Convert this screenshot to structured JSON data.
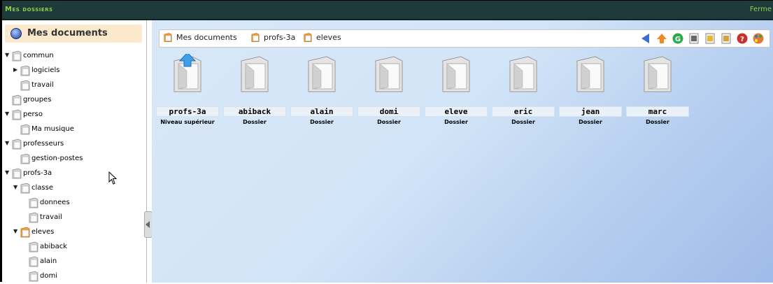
{
  "window": {
    "title": "Mes dossiers",
    "close_label": "Ferme"
  },
  "sidebar": {
    "header": "Mes documents",
    "items": [
      {
        "label": "commun",
        "arrow": "down"
      },
      {
        "label": "logiciels",
        "arrow": "right"
      },
      {
        "label": "travail",
        "arrow": ""
      },
      {
        "label": "groupes",
        "arrow": ""
      },
      {
        "label": "perso",
        "arrow": "down"
      },
      {
        "label": "Ma musique",
        "arrow": ""
      },
      {
        "label": "professeurs",
        "arrow": "down"
      },
      {
        "label": "gestion-postes",
        "arrow": ""
      },
      {
        "label": "profs-3a",
        "arrow": "down"
      },
      {
        "label": "classe",
        "arrow": "down"
      },
      {
        "label": "donnees",
        "arrow": ""
      },
      {
        "label": "travail",
        "arrow": ""
      },
      {
        "label": "eleves",
        "arrow": "down"
      },
      {
        "label": "abiback",
        "arrow": ""
      },
      {
        "label": "alain",
        "arrow": ""
      },
      {
        "label": "domi",
        "arrow": ""
      }
    ]
  },
  "breadcrumb": [
    "Mes documents",
    "profs-3a",
    "eleves"
  ],
  "toolbar_icons": [
    "back-icon",
    "up-icon",
    "refresh-icon",
    "tree-icon",
    "new-folder-icon",
    "calendar-icon",
    "help-icon",
    "palette-icon"
  ],
  "folders": [
    {
      "name": "profs-3a",
      "type": "Niveau supérieur",
      "icon": "parent-folder-icon"
    },
    {
      "name": "abiback",
      "type": "Dossier",
      "icon": "folder-icon"
    },
    {
      "name": "alain",
      "type": "Dossier",
      "icon": "folder-icon"
    },
    {
      "name": "domi",
      "type": "Dossier",
      "icon": "folder-icon"
    },
    {
      "name": "eleve",
      "type": "Dossier",
      "icon": "folder-icon"
    },
    {
      "name": "eric",
      "type": "Dossier",
      "icon": "folder-icon"
    },
    {
      "name": "jean",
      "type": "Dossier",
      "icon": "folder-icon"
    },
    {
      "name": "marc",
      "type": "Dossier",
      "icon": "folder-icon"
    }
  ],
  "colors": {
    "titlebar": "#1e3a3a",
    "title_text": "#8fd04a",
    "header_bg": "#fbe9cd",
    "content_bg": "#d2e4f7"
  }
}
